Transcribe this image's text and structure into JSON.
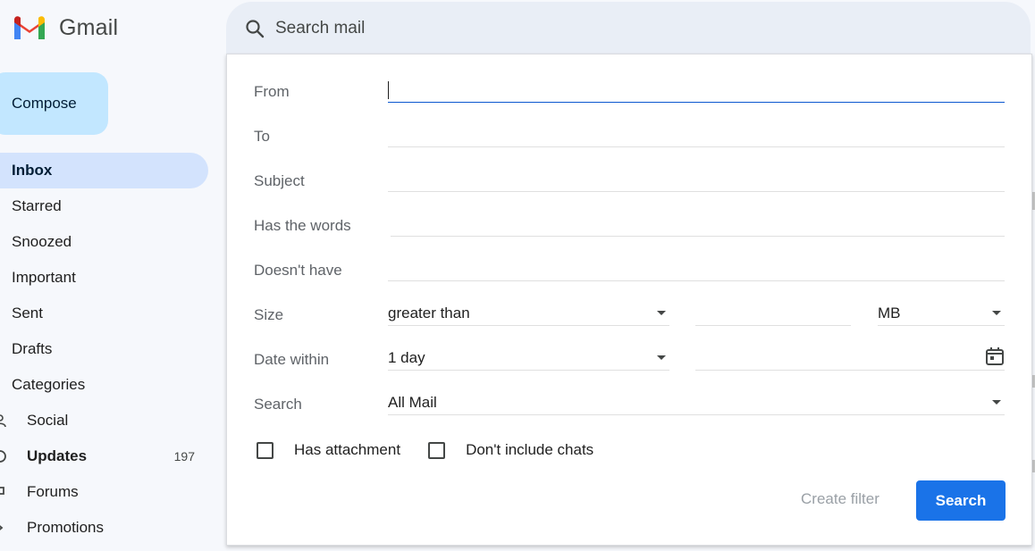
{
  "app": {
    "name": "Gmail"
  },
  "colors": {
    "accent": "#1a73e8",
    "compose": "#c2e7ff",
    "active_nav": "#d3e3fd",
    "search_bg": "#e9eef6"
  },
  "search": {
    "placeholder": "Search mail"
  },
  "sidebar": {
    "compose_label": "Compose",
    "items": [
      {
        "label": "Inbox"
      },
      {
        "label": "Starred"
      },
      {
        "label": "Snoozed"
      },
      {
        "label": "Important"
      },
      {
        "label": "Sent"
      },
      {
        "label": "Drafts"
      },
      {
        "label": "Categories"
      },
      {
        "label": "Social",
        "icon": "people-icon"
      },
      {
        "label": "Updates",
        "icon": "info-icon",
        "count": "197"
      },
      {
        "label": "Forums",
        "icon": "forum-icon"
      },
      {
        "label": "Promotions",
        "icon": "tag-icon"
      }
    ]
  },
  "advanced_search": {
    "from_label": "From",
    "to_label": "To",
    "subject_label": "Subject",
    "has_words_label": "Has the words",
    "doesnt_have_label": "Doesn't have",
    "size_label": "Size",
    "size_operator": "greater than",
    "size_unit": "MB",
    "date_within_label": "Date within",
    "date_within_value": "1 day",
    "search_label": "Search",
    "search_scope": "All Mail",
    "has_attachment_label": "Has attachment",
    "dont_include_chats_label": "Don't include chats",
    "create_filter_label": "Create filter",
    "search_button_label": "Search"
  }
}
